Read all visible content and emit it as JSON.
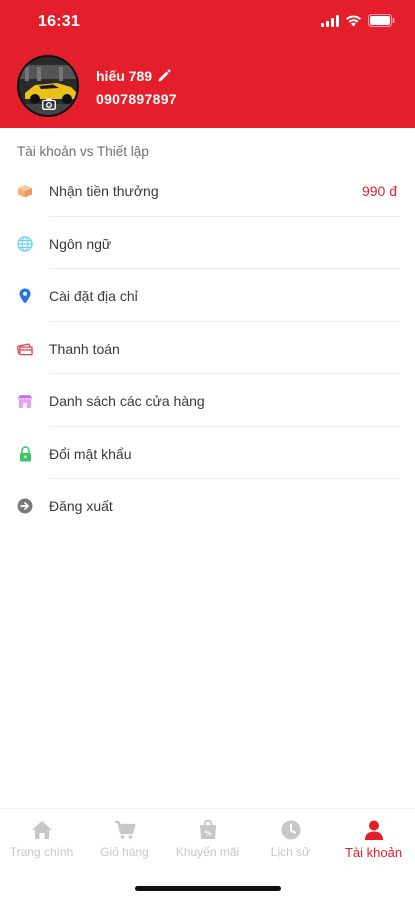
{
  "status_bar": {
    "time": "16:31"
  },
  "profile": {
    "name": "hiếu 789",
    "phone": "0907897897"
  },
  "section_title": "Tài khoản vs Thiết lập",
  "menu": [
    {
      "label": "Nhận tiền thưởng",
      "value": "990 đ",
      "icon": "gift-box-icon"
    },
    {
      "label": "Ngôn ngữ",
      "value": "",
      "icon": "globe-icon"
    },
    {
      "label": "Cài đặt địa chỉ",
      "value": "",
      "icon": "location-pin-icon"
    },
    {
      "label": "Thanh toán",
      "value": "",
      "icon": "payment-icon"
    },
    {
      "label": "Danh sách các cửa hàng",
      "value": "",
      "icon": "store-icon"
    },
    {
      "label": "Đổi mật khẩu",
      "value": "",
      "icon": "lock-icon"
    },
    {
      "label": "Đăng xuất",
      "value": "",
      "icon": "logout-icon"
    }
  ],
  "tabbar": [
    {
      "label": "Trang chính",
      "icon": "home-icon",
      "active": false
    },
    {
      "label": "Giỏ hàng",
      "icon": "cart-icon",
      "active": false
    },
    {
      "label": "Khuyến mãi",
      "icon": "promotion-icon",
      "active": false
    },
    {
      "label": "Lịch sử",
      "icon": "clock-icon",
      "active": false
    },
    {
      "label": "Tài khoản",
      "icon": "user-icon",
      "active": true
    }
  ],
  "colors": {
    "primary": "#e41e2b",
    "inactive": "#c7c7c7"
  }
}
